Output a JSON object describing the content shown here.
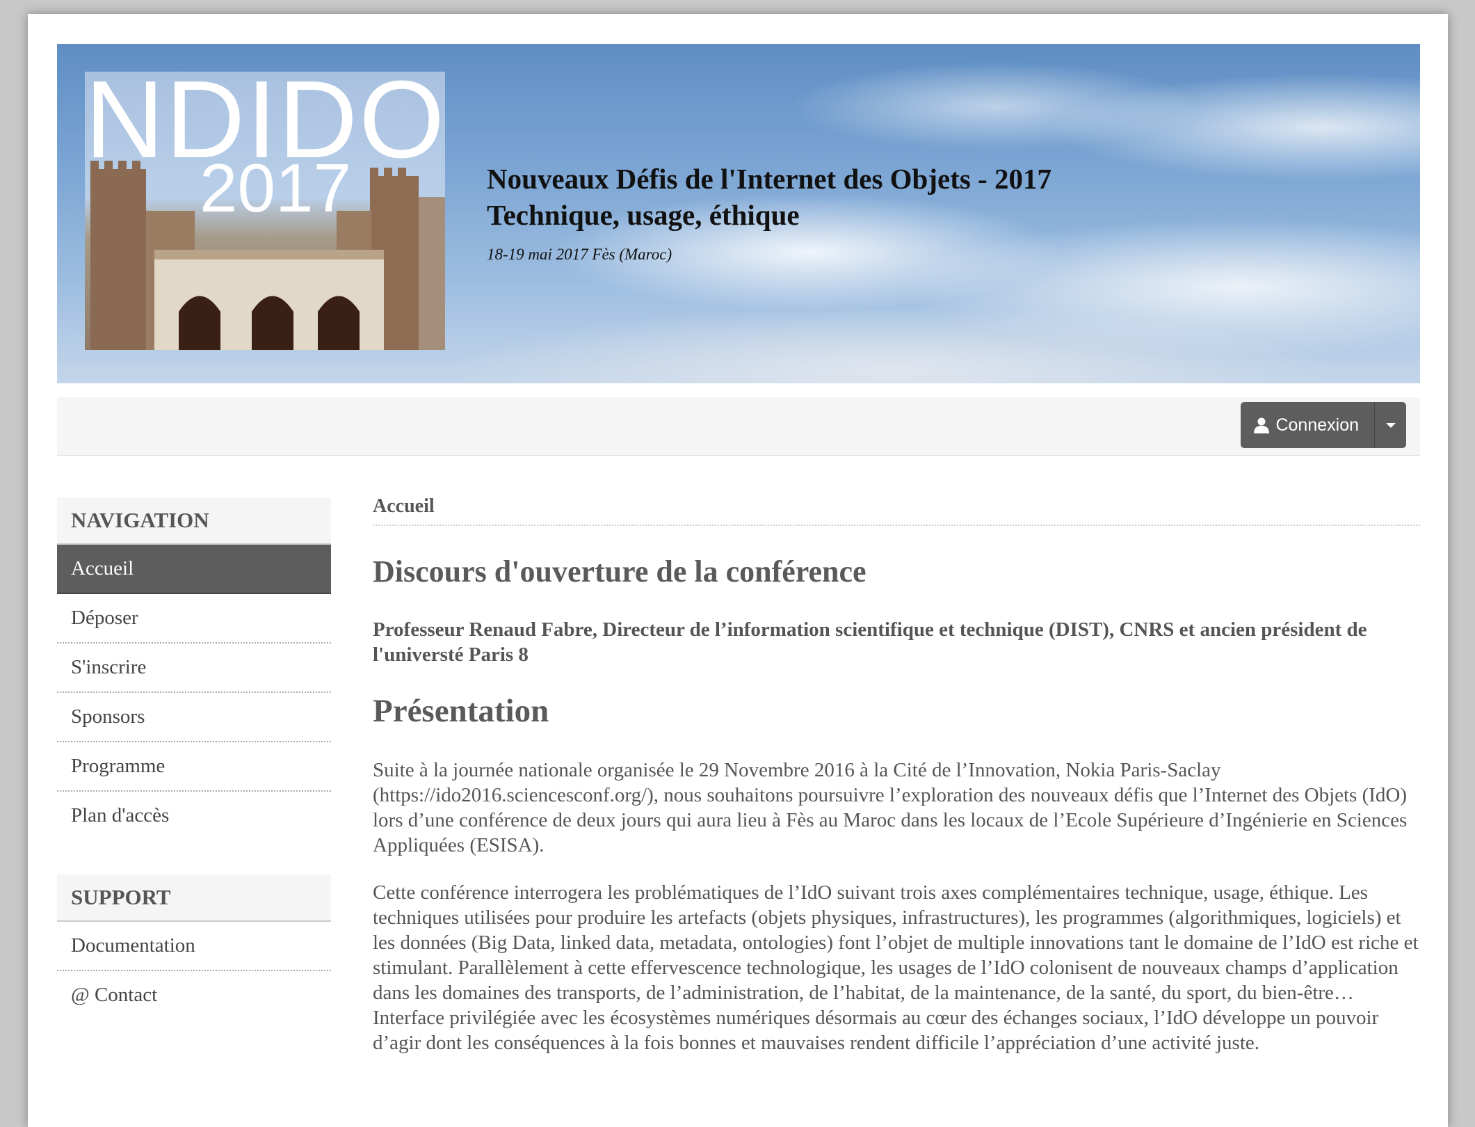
{
  "banner": {
    "logo_title": "NDIDO",
    "logo_year": "2017",
    "title_line1": "Nouveaux Défis de l'Internet des Objets - 2017",
    "title_line2": "Technique, usage, éthique",
    "subtitle": "18-19 mai 2017 Fès (Maroc)"
  },
  "toolbar": {
    "login_label": "Connexion"
  },
  "sidebar": {
    "navigation_header": "NAVIGATION",
    "nav_items": [
      {
        "label": "Accueil",
        "active": true
      },
      {
        "label": "Déposer"
      },
      {
        "label": "S'inscrire"
      },
      {
        "label": "Sponsors"
      },
      {
        "label": "Programme"
      },
      {
        "label": "Plan d'accès"
      }
    ],
    "support_header": "SUPPORT",
    "support_items": [
      {
        "label": "Documentation"
      },
      {
        "label": "@ Contact"
      }
    ]
  },
  "main": {
    "breadcrumb": "Accueil",
    "heading1": "Discours d'ouverture de la conférence",
    "speaker": "Professeur Renaud Fabre, Directeur de l’information scientifique et technique (DIST), CNRS et ancien président de l'universté Paris 8",
    "heading2": "Présentation",
    "paragraph1": "Suite à la journée nationale organisée le 29 Novembre 2016 à la Cité de l’Innovation, Nokia Paris-Saclay (https://ido2016.sciencesconf.org/), nous souhaitons poursuivre l’exploration des nouveaux défis que l’Internet des Objets (IdO) lors d’une conférence de deux jours qui aura lieu à Fès au Maroc dans les locaux de l’Ecole Supérieure d’Ingénierie en Sciences Appliquées (ESISA).",
    "paragraph2": "Cette conférence interrogera les problématiques de l’IdO suivant trois axes complémentaires technique, usage, éthique. Les techniques utilisées pour produire les artefacts (objets physiques, infrastructures), les programmes (algorithmiques, logiciels) et les données (Big Data, linked data, metadata, ontologies) font l’objet de multiple innovations tant le domaine de  l’IdO est riche et stimulant. Parallèlement à cette effervescence technologique, les usages de l’IdO colonisent de nouveaux champs d’application dans les domaines des transports, de l’administration, de l’habitat, de la maintenance, de la santé, du sport, du bien-être… Interface privilégiée avec les écosystèmes numériques désormais au cœur des échanges sociaux, l’IdO développe un pouvoir d’agir dont les conséquences à la fois bonnes et mauvaises rendent difficile l’appréciation d’une activité juste."
  }
}
